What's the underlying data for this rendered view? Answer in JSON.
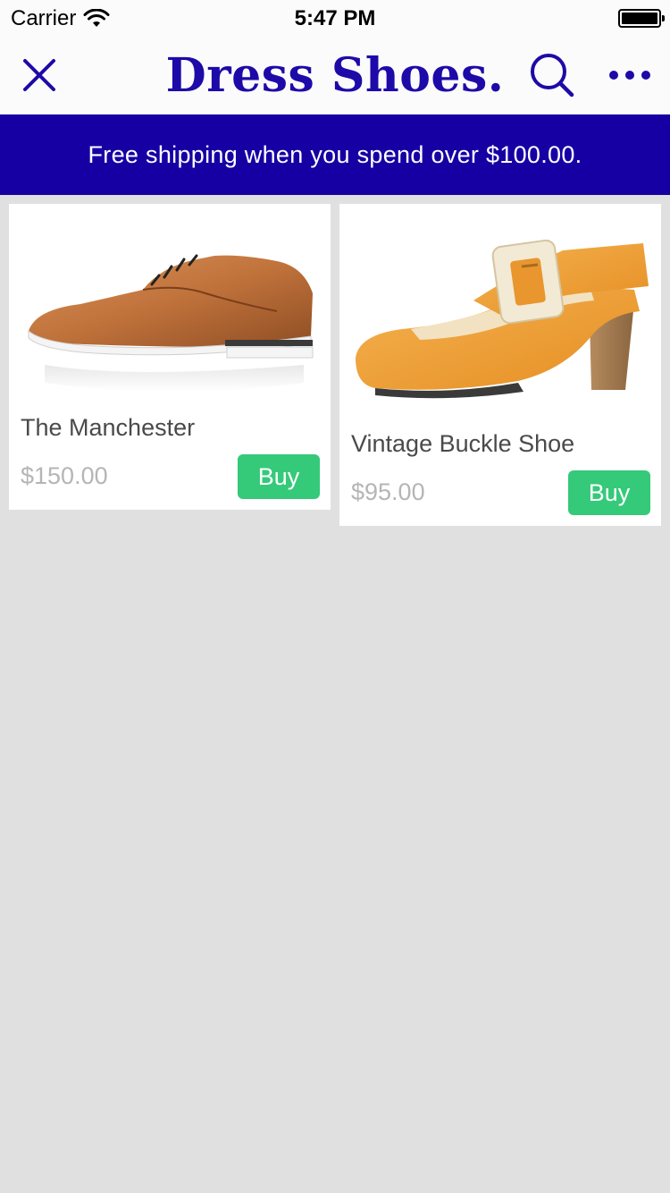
{
  "status_bar": {
    "carrier": "Carrier",
    "time": "5:47 PM",
    "wifi_icon": "wifi-icon",
    "battery_icon": "battery-icon"
  },
  "nav": {
    "title": "Dress Shoes.",
    "close_icon": "close-icon",
    "search_icon": "search-icon",
    "more_icon": "more-icon",
    "title_color": "#1d0aa8"
  },
  "banner": {
    "text": "Free shipping when you spend over $100.00.",
    "color": "#1600a3"
  },
  "products": [
    {
      "name": "The Manchester",
      "price": "$150.00",
      "buy_label": "Buy",
      "image": "brown-leather-oxford-shoe"
    },
    {
      "name": "Vintage Buckle Shoe",
      "price": "$95.00",
      "buy_label": "Buy",
      "image": "orange-buckle-heel-shoe"
    }
  ],
  "colors": {
    "buy_button": "#35c97a",
    "background": "#e0e0e0"
  }
}
